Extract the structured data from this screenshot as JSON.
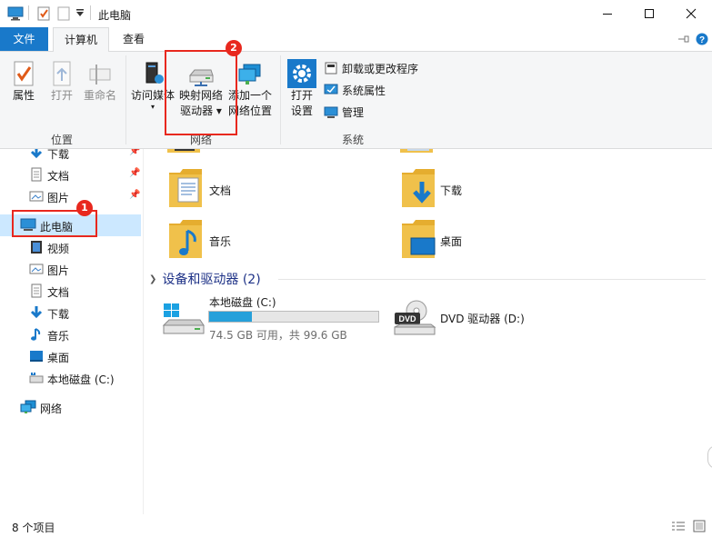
{
  "window": {
    "title": "此电脑",
    "controls": [
      "minimize-icon",
      "maximize-icon",
      "close-icon"
    ]
  },
  "tabs": {
    "file": "文件",
    "computer": "计算机",
    "view": "查看"
  },
  "ribbon": {
    "location_group": {
      "label": "位置",
      "properties": "属性",
      "open": "打开",
      "rename": "重命名"
    },
    "network_group": {
      "label": "网络",
      "access_media": "访问媒体",
      "map_drive_line1": "映射网络",
      "map_drive_line2": "驱动器 ▾",
      "add_location_line1": "添加一个",
      "add_location_line2": "网络位置"
    },
    "system_group": {
      "label": "系统",
      "open_settings_line1": "打开",
      "open_settings_line2": "设置",
      "uninstall": "卸载或更改程序",
      "system_properties": "系统属性",
      "manage": "管理"
    }
  },
  "annotations": {
    "badge1": "1",
    "badge2": "2",
    "highlight_color": "#e8281e"
  },
  "nav": {
    "items": [
      {
        "label": "下载",
        "icon": "download-arrow-icon",
        "pinned": true
      },
      {
        "label": "文档",
        "icon": "document-icon",
        "pinned": true
      },
      {
        "label": "图片",
        "icon": "picture-icon",
        "pinned": true
      },
      {
        "label": "此电脑",
        "icon": "computer-icon",
        "selected": true
      },
      {
        "label": "视频",
        "icon": "video-icon"
      },
      {
        "label": "图片",
        "icon": "picture-icon"
      },
      {
        "label": "文档",
        "icon": "document-icon"
      },
      {
        "label": "下载",
        "icon": "download-arrow-icon"
      },
      {
        "label": "音乐",
        "icon": "music-note-icon"
      },
      {
        "label": "桌面",
        "icon": "desktop-icon"
      },
      {
        "label": "本地磁盘 (C:)",
        "icon": "drive-icon"
      },
      {
        "label": "网络",
        "icon": "network-icon"
      }
    ]
  },
  "content": {
    "folders": [
      {
        "label": "文档",
        "icon": "documents-folder-icon"
      },
      {
        "label": "下载",
        "icon": "downloads-folder-icon"
      },
      {
        "label": "音乐",
        "icon": "music-folder-icon"
      },
      {
        "label": "桌面",
        "icon": "desktop-folder-icon"
      }
    ],
    "devices_header": "设备和驱动器 (2)",
    "drives": [
      {
        "name": "本地磁盘 (C:)",
        "space": "74.5 GB 可用，共 99.6 GB",
        "used_fraction": 0.252,
        "icon": "windows-drive-icon"
      },
      {
        "name": "DVD 驱动器 (D:)",
        "icon": "dvd-drive-icon"
      }
    ]
  },
  "status": {
    "item_count": "8 个项目"
  },
  "colors": {
    "accent": "#1979ca",
    "selection": "#cce8ff",
    "drive_bar": "#26a0da",
    "folder": "#f0c14b"
  }
}
